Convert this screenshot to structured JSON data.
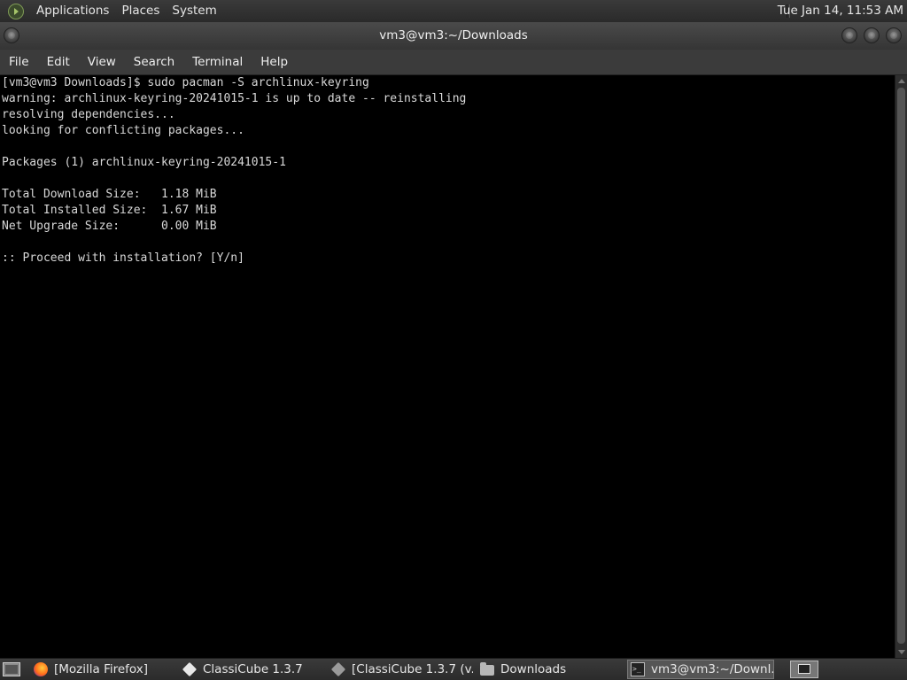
{
  "top_panel": {
    "menus": [
      "Applications",
      "Places",
      "System"
    ],
    "clock": "Tue Jan 14, 11:53 AM"
  },
  "window": {
    "title": "vm3@vm3:~/Downloads",
    "menubar": [
      "File",
      "Edit",
      "View",
      "Search",
      "Terminal",
      "Help"
    ]
  },
  "terminal": {
    "lines": [
      "[vm3@vm3 Downloads]$ sudo pacman -S archlinux-keyring",
      "warning: archlinux-keyring-20241015-1 is up to date -- reinstalling",
      "resolving dependencies...",
      "looking for conflicting packages...",
      "",
      "Packages (1) archlinux-keyring-20241015-1",
      "",
      "Total Download Size:   1.18 MiB",
      "Total Installed Size:  1.67 MiB",
      "Net Upgrade Size:      0.00 MiB",
      "",
      ":: Proceed with installation? [Y/n]"
    ]
  },
  "taskbar": {
    "tasks": [
      {
        "label": "[Mozilla Firefox]",
        "icon": "firefox-icon",
        "active": false
      },
      {
        "label": "ClassiCube 1.3.7",
        "icon": "cube-icon",
        "active": false
      },
      {
        "label": "[ClassiCube 1.3.7 (v...",
        "icon": "cube-icon",
        "active": false
      },
      {
        "label": "Downloads",
        "icon": "folder-icon",
        "active": false
      },
      {
        "label": "vm3@vm3:~/Downl...",
        "icon": "terminal-icon",
        "active": true
      }
    ]
  }
}
